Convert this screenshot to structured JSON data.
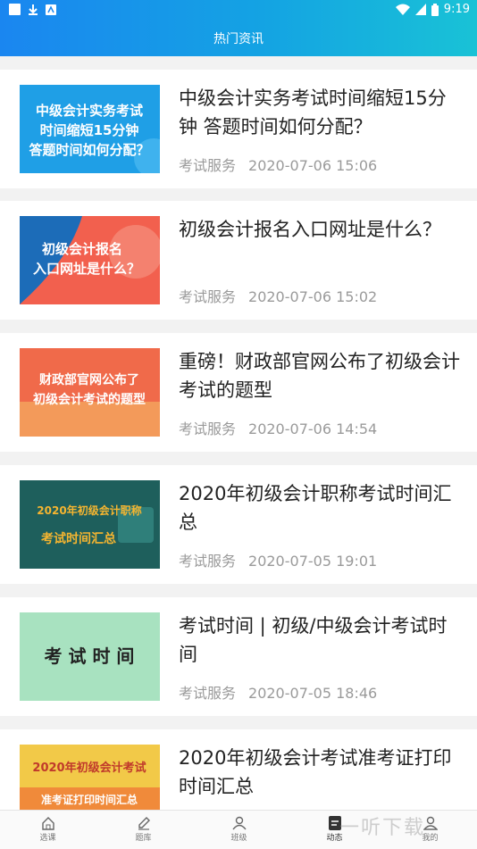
{
  "status_bar": {
    "time": "9:19"
  },
  "header": {
    "title": "热门资讯"
  },
  "articles": [
    {
      "title": "中级会计实务考试时间缩短15分钟 答题时间如何分配？",
      "source": "考试服务",
      "date": "2020-07-06 15:06",
      "thumb_text": [
        "中级会计实务考试",
        "时间缩短15分钟",
        "答题时间如何分配？"
      ]
    },
    {
      "title": "初级会计报名入口网址是什么？",
      "source": "考试服务",
      "date": "2020-07-06 15:02",
      "thumb_text": [
        "初级会计报名",
        "入口网址是什么？"
      ]
    },
    {
      "title": "重磅！财政部官网公布了初级会计考试的题型",
      "source": "考试服务",
      "date": "2020-07-06 14:54",
      "thumb_text": [
        "财政部官网公布了",
        "初级会计考试的题型"
      ]
    },
    {
      "title": "2020年初级会计职称考试时间汇总",
      "source": "考试服务",
      "date": "2020-07-05 19:01",
      "thumb_text": [
        "2020年初级会计职称",
        "考试时间汇总"
      ]
    },
    {
      "title": "考试时间 | 初级/中级会计考试时间",
      "source": "考试服务",
      "date": "2020-07-05 18:46",
      "thumb_text": [
        "考 试 时 间"
      ]
    },
    {
      "title": "2020年初级会计考试准考证打印时间汇总",
      "source": "",
      "date": "",
      "thumb_text": [
        "2020年初级会计考试",
        "准考证打印时间汇总"
      ]
    }
  ],
  "tabs": [
    {
      "label": "选课",
      "icon": "home-icon"
    },
    {
      "label": "题库",
      "icon": "pencil-icon"
    },
    {
      "label": "班级",
      "icon": "class-icon"
    },
    {
      "label": "动态",
      "icon": "news-icon",
      "active": true
    },
    {
      "label": "我的",
      "icon": "user-icon"
    }
  ],
  "watermark": "一听下载",
  "colors": {
    "header_start": "#1a86f0",
    "header_end": "#19c2d6"
  }
}
